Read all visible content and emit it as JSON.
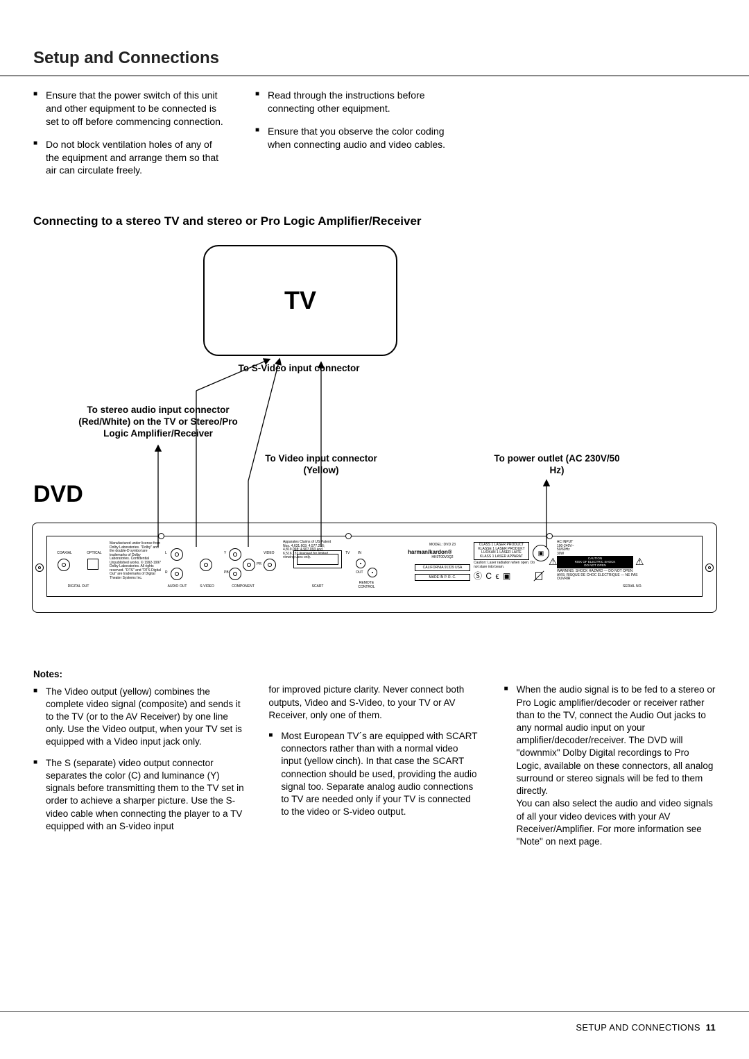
{
  "page_title": "Setup and Connections",
  "top_bullets_col1": [
    "Ensure that the power switch of this unit and other equipment to be connected is set to off before commencing connection.",
    "Do not block ventilation holes of any of the equipment and arrange them so that air can circulate freely."
  ],
  "top_bullets_col2": [
    "Read through the instructions before connecting other equipment.",
    "Ensure that you observe the color coding when connecting audio and video cables."
  ],
  "subheading": "Connecting to a stereo TV and stereo or Pro Logic Amplifier/Receiver",
  "diagram": {
    "tv_label": "TV",
    "dvd_label": "DVD",
    "svideo_label": "To S-Video input connector",
    "stereo_audio_label": "To stereo audio input connector (Red/White) on the TV or Stereo/Pro Logic Amplifier/Receiver",
    "video_label": "To Video input connector (Yellow)",
    "power_label": "To power outlet (AC 230V/50 Hz)",
    "panel": {
      "digital_out": "DIGITAL OUT",
      "coaxial": "COAXIAL",
      "optical": "OPTICAL",
      "audio_out": "AUDIO OUT",
      "l": "L",
      "r": "R",
      "svideo": "S-VIDEO",
      "component": "COMPONENT",
      "y": "Y",
      "pr": "PR",
      "pb": "PB",
      "video": "VIDEO",
      "scart": "SCART",
      "tv": "TV",
      "in": "IN",
      "out": "OUT",
      "remote": "REMOTE CONTROL",
      "model": "MODEL: DVD 23",
      "brand": "harman/kardon®",
      "brand_sub": "HK9T00V0Q2",
      "california": "CALIFORNIA 91329 USA",
      "made": "MADE IN P. R. C.",
      "laser_box": "CLASS 1 LASER PRODUCT\nKLASSE 1 LASER PRODUKT\nLUOKAN 1 LASER LAITE\nKLASS 1 LASER APPARAT",
      "laser_caution": "Caution: Laser radiation when open. Do not stare into beam.",
      "ac": "AC INPUT\n100-240V~\n50/60Hz\n30W",
      "caution_box": "CAUTION\nRISK OF ELECTRIC SHOCK\nDO NOT OPEN",
      "caution_sub": "WARNING: SHOCK HAZARD — DO NOT OPEN\nAVIS: RISQUE DE CHOC ÉLECTRIQUE — NE PAS OUVRIR",
      "serial": "SERIAL NO.",
      "dolby_text": "Manufactured under license from Dolby Laboratories. \"Dolby\" and the double-D symbol are trademarks of Dolby Laboratories. Confidential Unpublished works. © 1992-1997 Dolby Laboratories. All rights reserved. \"DTS\" and \"DTS Digital Out\" are trademarks of Digital Theater Systems Inc.",
      "patents": "Apparates Claims of US Patent Nos. 4,631,603; 4,577,216; 4,819,098; 4,907,093 and 6,516,132 licensed for limited viewing uses only."
    }
  },
  "notes_heading": "Notes:",
  "notes_col1": [
    "The Video output (yellow) combines the complete video signal (composite) and sends it to the TV (or to the AV Receiver) by one line only. Use the Video output, when your TV set is equipped with a Video input jack only.",
    "The S (separate) video output connector separates the color (C) and luminance (Y) signals before transmitting them to the TV set in order to achieve a sharper picture. Use the S-video cable when connecting the player to a TV equipped with an S-video input"
  ],
  "notes_col2_cont": "for improved picture clarity. Never connect both outputs, Video and S-Video, to your TV or AV Receiver, only one of them.",
  "notes_col2": [
    "Most European TV´s are equipped with SCART connectors rather than with a normal video input (yellow cinch). In that case the SCART connection should be used, providing the audio signal too. Separate analog audio connections to TV are needed only if your TV is connected to the video or S-video output."
  ],
  "notes_col3": [
    "When the audio signal is to be fed to a stereo or Pro Logic amplifier/decoder or receiver rather than to the TV, connect the Audio Out jacks to any normal audio input on your amplifier/decoder/receiver. The DVD will \"downmix\" Dolby Digital recordings to Pro Logic, available on these connectors, all analog surround or stereo signals will be fed to them directly.\nYou can also select the audio and video signals of all your video devices with your AV Receiver/Amplifier. For more information see \"Note\" on next page."
  ],
  "footer_label": "SETUP AND CONNECTIONS",
  "footer_page": "11"
}
